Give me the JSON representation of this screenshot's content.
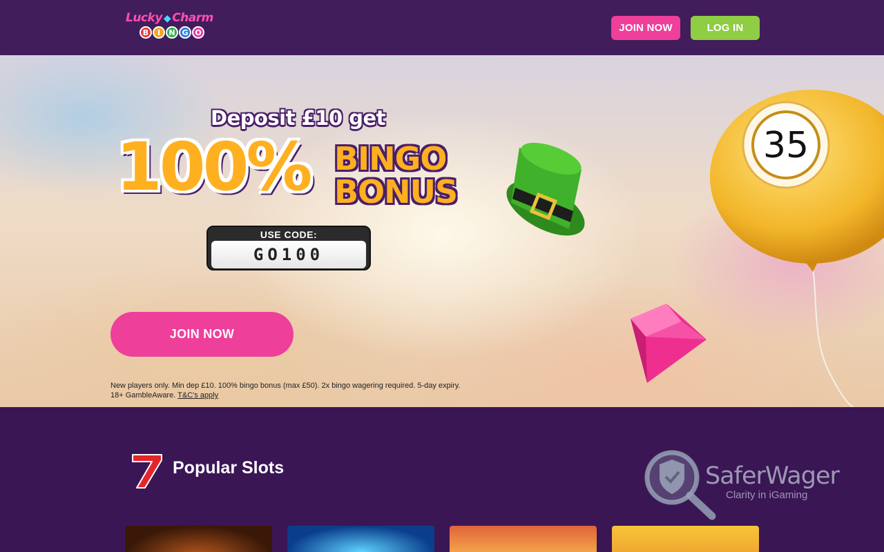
{
  "header": {
    "logo": {
      "line1_left": "Lucky",
      "line1_right": "Charm",
      "balls": [
        "B",
        "I",
        "N",
        "G",
        "O"
      ],
      "ball_colors": [
        "#e83a3a",
        "#f5a623",
        "#2fb34b",
        "#2f7de1",
        "#e83aa8"
      ]
    },
    "join_label": "JOIN NOW",
    "login_label": "LOG IN"
  },
  "hero": {
    "line1": "Deposit £10 get",
    "big_percent": "100%",
    "word1": "BINGO",
    "word2": "BONUS",
    "code_label": "USE CODE:",
    "code_value": "GO100",
    "join_label": "JOIN NOW",
    "terms_line1": "New players only. Min dep £10. 100% bingo bonus (max £50). 2x bingo wagering required. 5-day expiry.",
    "terms_line2": "18+ GambleAware. ",
    "terms_link": "T&C's apply",
    "ball_number": "35"
  },
  "section": {
    "title": "Popular Slots",
    "icon": "lucky-seven-icon"
  },
  "watermark": {
    "name": "SaferWager",
    "tagline": "Clarity in iGaming"
  },
  "colors": {
    "header_bg": "#411d5c",
    "page_bg": "#3a1655",
    "pink": "#ee3f9b",
    "green": "#8fcd44"
  }
}
